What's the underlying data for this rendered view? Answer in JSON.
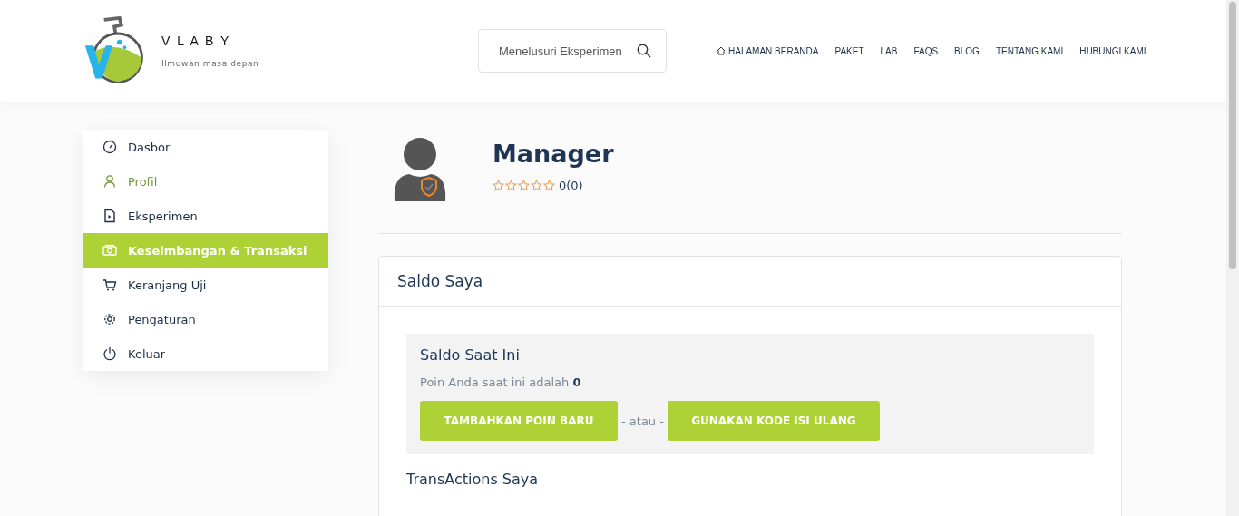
{
  "brand": {
    "name": "V L A B Y",
    "tagline": "Ilmuwan masa depan"
  },
  "search": {
    "placeholder": "Menelusuri Eksperimen"
  },
  "nav": [
    {
      "label": "HALAMAN BERANDA",
      "kind": "home"
    },
    {
      "label": "PAKET",
      "kind": "text"
    },
    {
      "label": "LAB",
      "kind": "text"
    },
    {
      "label": "FAQS",
      "kind": "text"
    },
    {
      "label": "BLOG",
      "kind": "text"
    },
    {
      "label": "TENTANG KAMI",
      "kind": "text"
    },
    {
      "label": "HUBUNGI KAMI",
      "kind": "text"
    }
  ],
  "sidebar": {
    "items": [
      {
        "label": "Dasbor",
        "kind": "gauge",
        "selected": false,
        "hovered": false
      },
      {
        "label": "Profil",
        "kind": "user",
        "selected": false,
        "hovered": true
      },
      {
        "label": "Eksperimen",
        "kind": "file",
        "selected": false,
        "hovered": false
      },
      {
        "label": "Keseimbangan & Transaksi",
        "kind": "money",
        "selected": true,
        "hovered": false
      },
      {
        "label": "Keranjang Uji",
        "kind": "cart",
        "selected": false,
        "hovered": false
      },
      {
        "label": "Pengaturan",
        "kind": "gear",
        "selected": false,
        "hovered": false
      },
      {
        "label": "Keluar",
        "kind": "power",
        "selected": false,
        "hovered": false
      }
    ]
  },
  "profile": {
    "name": "Manager",
    "stars": 0,
    "rating": "0(0)"
  },
  "balance_card": {
    "title": "Saldo Saya",
    "current_title": "Saldo Saat Ini",
    "points_text": "Poin Anda saat ini adalah **0**",
    "buttons": [
      "TAMBAHKAN POIN BARU",
      "GUNAKAN KODE ISI ULANG"
    ],
    "separator": "- atau -",
    "transactions_title": "TransActions Saya"
  }
}
